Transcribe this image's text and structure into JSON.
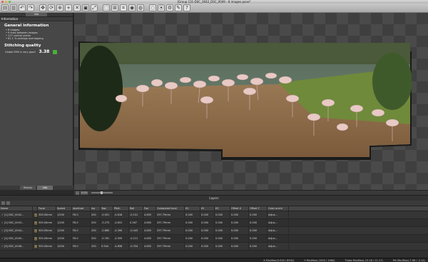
{
  "window": {
    "title": "[Group 131-DSC_0042_DSC_0049 - 8 images.pano*"
  },
  "toolbar": {
    "icons": [
      "open-icon",
      "save-icon",
      "undo-icon",
      "redo-icon",
      "move-icon",
      "rotate-icon",
      "pin-icon",
      "add-point-icon",
      "remove-point-icon",
      "crop-icon",
      "fit-icon",
      "frame-icon",
      "straighten-icon",
      "grid-icon",
      "preview-icon",
      "edit-mask-icon",
      "globe-icon",
      "zoom-icon",
      "gear-icon",
      "wrench-icon",
      "help-icon"
    ],
    "glyphs": [
      "▤",
      "▥",
      "↶",
      "↷",
      "✥",
      "⟳",
      "⊕",
      "+",
      "✕",
      "▣",
      "⤢",
      "⬚",
      "⊞",
      "⌗",
      "◉",
      "◍",
      "◌",
      "⦿",
      "⚙",
      "✎",
      "?"
    ]
  },
  "left_panel": {
    "top_tab": "Info",
    "section_title": "Information",
    "general_heading": "General information",
    "general_lines": [
      "• 8 images",
      "• 9 links between images",
      "• 117 control points",
      "• 81.1 % average overlapping"
    ],
    "quality_heading": "Stitching quality",
    "rms_label": "Global RMS is very good",
    "rms_value": "3.38",
    "tabs": {
      "history": "History",
      "info": "Info"
    }
  },
  "viewport_bar": {
    "zoom": "100%"
  },
  "layers": {
    "title": "Layers",
    "columns": [
      "Name",
      "",
      "Focal",
      "Speed",
      "Aperture",
      "Iso",
      "Yaw",
      "Pitch",
      "Roll",
      "Fov",
      "Computed focal",
      "K1",
      "K2",
      "K3",
      "Offset X",
      "Offset Y",
      "Color anchr"
    ],
    "rows": [
      {
        "name": "[1] DSC_0042...",
        "focal": "300.00mm",
        "speed": "1/200",
        "aperture": "F8.0",
        "iso": "200",
        "yaw": "-0.051",
        "pitch": "-4.618",
        "roll": "-0.151",
        "fov": "4.605",
        "computed": "297.79mm",
        "k1": "0.000",
        "k2": "0.000",
        "k3": "0.000",
        "ox": "0.000",
        "oy": "0.000",
        "anchor": "Adjus..."
      },
      {
        "name": "[2] DSC_0043...",
        "focal": "300.00mm",
        "speed": "1/200",
        "aperture": "F8.0",
        "iso": "200",
        "yaw": "-3.275",
        "pitch": "-4.631",
        "roll": "0.267",
        "fov": "4.605",
        "computed": "297.79mm",
        "k1": "0.000",
        "k2": "0.000",
        "k3": "0.000",
        "ox": "0.000",
        "oy": "0.000",
        "anchor": "Adjus..."
      },
      {
        "name": "[3] DSC_0044...",
        "focal": "300.00mm",
        "speed": "1/200",
        "aperture": "F8.0",
        "iso": "200",
        "yaw": "-2.865",
        "pitch": "-4.390",
        "roll": "-0.443",
        "fov": "4.605",
        "computed": "297.79mm",
        "k1": "0.000",
        "k2": "0.000",
        "k3": "0.000",
        "ox": "0.000",
        "oy": "0.000",
        "anchor": "Adjus..."
      },
      {
        "name": "[4] DSC_0045...",
        "focal": "300.00mm",
        "speed": "1/200",
        "aperture": "F8.0",
        "iso": "200",
        "yaw": "-0.761",
        "pitch": "-4.559",
        "roll": "-0.211",
        "fov": "4.605",
        "computed": "297.79mm",
        "k1": "0.000",
        "k2": "0.000",
        "k3": "0.000",
        "ox": "0.000",
        "oy": "0.000",
        "anchor": "Adjus..."
      },
      {
        "name": "[5] DSC_0046...",
        "focal": "300.00mm",
        "speed": "1/200",
        "aperture": "F8.0",
        "iso": "200",
        "yaw": "0.944",
        "pitch": "-4.858",
        "roll": "-0.334",
        "fov": "4.605",
        "computed": "297.79mm",
        "k1": "0.000",
        "k2": "0.000",
        "k3": "0.000",
        "ox": "0.000",
        "oy": "0.000",
        "anchor": "Adjus..."
      }
    ]
  },
  "status": {
    "a": "X Min/Max(0.918 / 8502)",
    "b": "Y Min/Max(-1550 / 1960)",
    "c": "Theta Min/Max(-13.16 / 11.17)",
    "d": "Phi Min/Max(-7.96 / -2.14)"
  },
  "colors": {
    "ok_green": "#4aae3a",
    "panel": "#474747",
    "checker_dark": "#3f3f3f",
    "checker_light": "#4a4a4a"
  }
}
